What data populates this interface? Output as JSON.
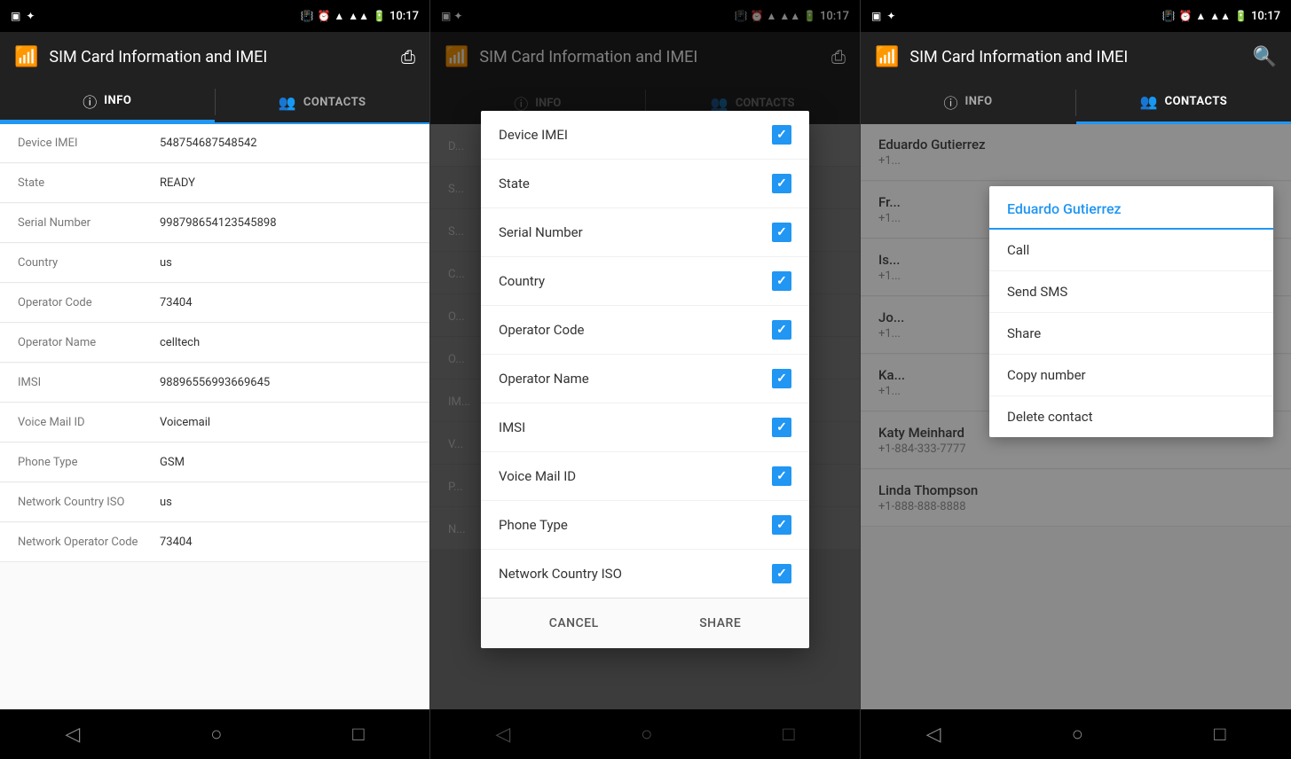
{
  "panels": {
    "left": {
      "statusBar": {
        "time": "10:17",
        "icons": [
          "battery",
          "signal",
          "wifi",
          "clock"
        ]
      },
      "appBar": {
        "title": "SIM Card Information and IMEI",
        "shareLabel": "share"
      },
      "tabs": [
        {
          "id": "info",
          "icon": "ⓘ",
          "label": "INFO",
          "active": true
        },
        {
          "id": "contacts",
          "icon": "👥",
          "label": "CONTACTS",
          "active": false
        }
      ],
      "infoRows": [
        {
          "label": "Device IMEI",
          "value": "548754687548542"
        },
        {
          "label": "State",
          "value": "READY"
        },
        {
          "label": "Serial Number",
          "value": "998798654123545898"
        },
        {
          "label": "Country",
          "value": "us"
        },
        {
          "label": "Operator Code",
          "value": "73404"
        },
        {
          "label": "Operator Name",
          "value": "celltech"
        },
        {
          "label": "IMSI",
          "value": "98896556993669645"
        },
        {
          "label": "Voice Mail ID",
          "value": "Voicemail"
        },
        {
          "label": "Phone Type",
          "value": "GSM"
        },
        {
          "label": "Network Country ISO",
          "value": "us"
        },
        {
          "label": "Network Operator Code",
          "value": "73404"
        }
      ],
      "navBar": {
        "back": "◁",
        "home": "○",
        "recent": "□"
      }
    },
    "middle": {
      "statusBar": {
        "time": "10:17"
      },
      "appBar": {
        "title": "SIM Card Information and IMEI",
        "shareLabel": "share"
      },
      "tabs": [
        {
          "id": "info",
          "icon": "ⓘ",
          "label": "INFO",
          "active": false
        },
        {
          "id": "contacts",
          "icon": "👥",
          "label": "CONTACTS",
          "active": false
        }
      ],
      "dialog": {
        "items": [
          {
            "label": "Device IMEI",
            "checked": true
          },
          {
            "label": "State",
            "checked": true
          },
          {
            "label": "Serial Number",
            "checked": true
          },
          {
            "label": "Country",
            "checked": true
          },
          {
            "label": "Operator Code",
            "checked": true
          },
          {
            "label": "Operator Name",
            "checked": true
          },
          {
            "label": "IMSI",
            "checked": true
          },
          {
            "label": "Voice Mail ID",
            "checked": true
          },
          {
            "label": "Phone Type",
            "checked": true
          },
          {
            "label": "Network Country ISO",
            "checked": true
          }
        ],
        "cancelLabel": "Cancel",
        "shareLabel": "Share"
      },
      "navBar": {
        "back": "◁",
        "home": "○",
        "recent": "□"
      }
    },
    "right": {
      "statusBar": {
        "time": "10:17"
      },
      "appBar": {
        "title": "SIM Card Information and IMEI",
        "searchLabel": "search"
      },
      "tabs": [
        {
          "id": "info",
          "icon": "ⓘ",
          "label": "INFO",
          "active": false
        },
        {
          "id": "contacts",
          "icon": "👥",
          "label": "CONTACTS",
          "active": true
        }
      ],
      "contacts": [
        {
          "name": "Eduardo Gutierrez",
          "phone": "+1..."
        },
        {
          "name": "Fr...",
          "phone": "+1..."
        },
        {
          "name": "Is...",
          "phone": "+1..."
        },
        {
          "name": "Jo...",
          "phone": "+1..."
        },
        {
          "name": "Ka...",
          "phone": "+1..."
        },
        {
          "name": "Katy Meinhard",
          "phone": "+1-884-333-7777"
        },
        {
          "name": "Linda Thompson",
          "phone": "+1-888-888-8888"
        }
      ],
      "contextMenu": {
        "title": "Eduardo Gutierrez",
        "items": [
          {
            "label": "Call"
          },
          {
            "label": "Send SMS"
          },
          {
            "label": "Share"
          },
          {
            "label": "Copy number"
          },
          {
            "label": "Delete contact"
          }
        ]
      },
      "navBar": {
        "back": "◁",
        "home": "○",
        "recent": "□"
      }
    }
  }
}
